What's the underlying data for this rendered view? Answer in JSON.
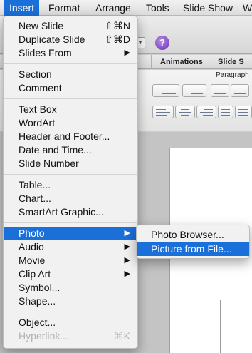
{
  "menubar": {
    "items": [
      "Insert",
      "Format",
      "Arrange",
      "Tools",
      "Slide Show",
      "W"
    ]
  },
  "ribbon": {
    "tabs": [
      "Animations",
      "Slide S"
    ],
    "group_label": "Paragraph"
  },
  "insert_menu": {
    "groups": [
      [
        {
          "label": "New Slide",
          "shortcut": "⇧⌘N"
        },
        {
          "label": "Duplicate Slide",
          "shortcut": "⇧⌘D"
        },
        {
          "label": "Slides From",
          "submenu": true
        }
      ],
      [
        {
          "label": "Section"
        },
        {
          "label": "Comment"
        }
      ],
      [
        {
          "label": "Text Box"
        },
        {
          "label": "WordArt"
        },
        {
          "label": "Header and Footer..."
        },
        {
          "label": "Date and Time..."
        },
        {
          "label": "Slide Number"
        }
      ],
      [
        {
          "label": "Table..."
        },
        {
          "label": "Chart..."
        },
        {
          "label": "SmartArt Graphic..."
        }
      ],
      [
        {
          "label": "Photo",
          "submenu": true,
          "highlighted": true
        },
        {
          "label": "Audio",
          "submenu": true
        },
        {
          "label": "Movie",
          "submenu": true
        },
        {
          "label": "Clip Art",
          "submenu": true
        },
        {
          "label": "Symbol..."
        },
        {
          "label": "Shape..."
        }
      ],
      [
        {
          "label": "Object..."
        },
        {
          "label": "Hyperlink...",
          "shortcut": "⌘K",
          "disabled": true
        }
      ]
    ]
  },
  "photo_submenu": {
    "items": [
      {
        "label": "Photo Browser..."
      },
      {
        "label": "Picture from File...",
        "highlighted": true
      }
    ]
  },
  "colors": {
    "highlight": "#1b6fd8",
    "menu_bg": "#f1f1f1",
    "disabled_text": "#b3b3b3"
  }
}
